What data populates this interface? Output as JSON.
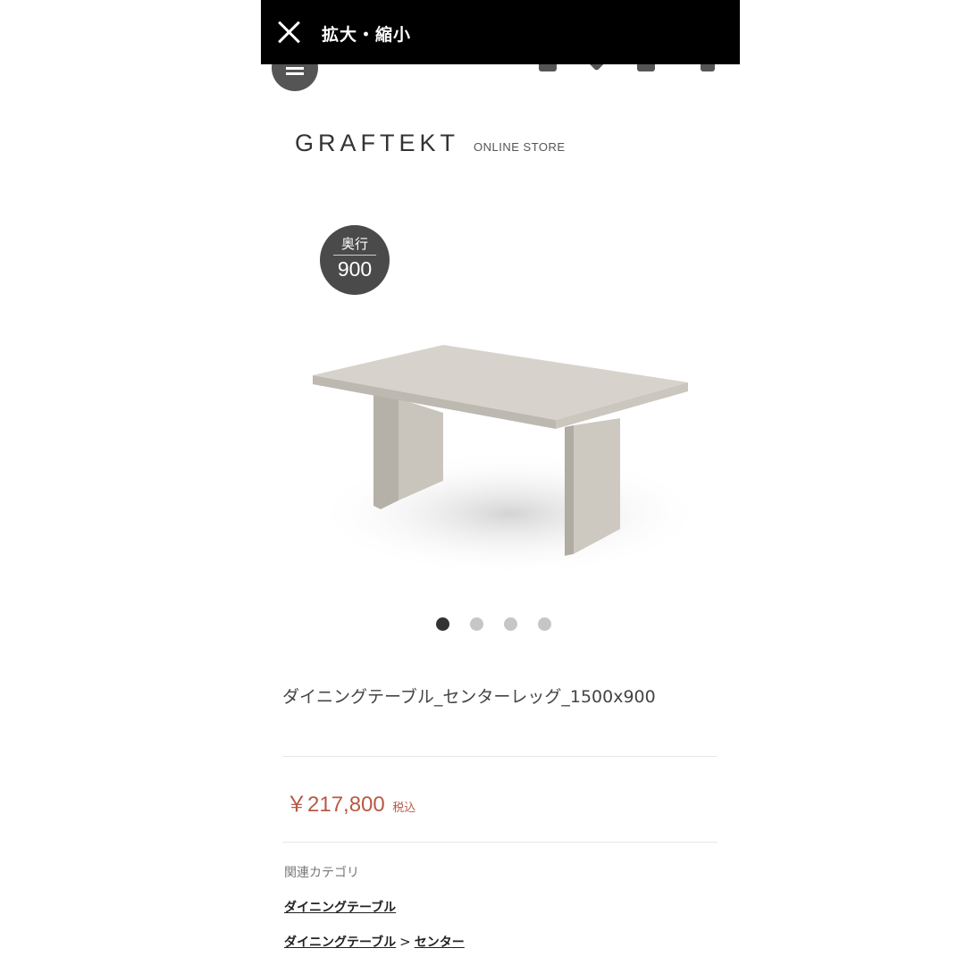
{
  "overlay": {
    "title": "拡大・縮小"
  },
  "brand": {
    "name": "GRAFTEKT",
    "sub": "ONLINE STORE"
  },
  "badge": {
    "label": "奥行",
    "value": "900"
  },
  "carousel": {
    "count": 4,
    "active": 0
  },
  "product": {
    "title": "ダイニングテーブル_センターレッグ_1500x900",
    "price": "￥217,800",
    "tax_label": "税込"
  },
  "related": {
    "heading": "関連カテゴリ",
    "link1": "ダイニングテーブル",
    "link2_parent": "ダイニングテーブル",
    "separator": ">",
    "link2_child": "センター"
  },
  "colors": {
    "price": "#b85a46",
    "overlay": "#000000",
    "badge": "#4a4a4a"
  }
}
